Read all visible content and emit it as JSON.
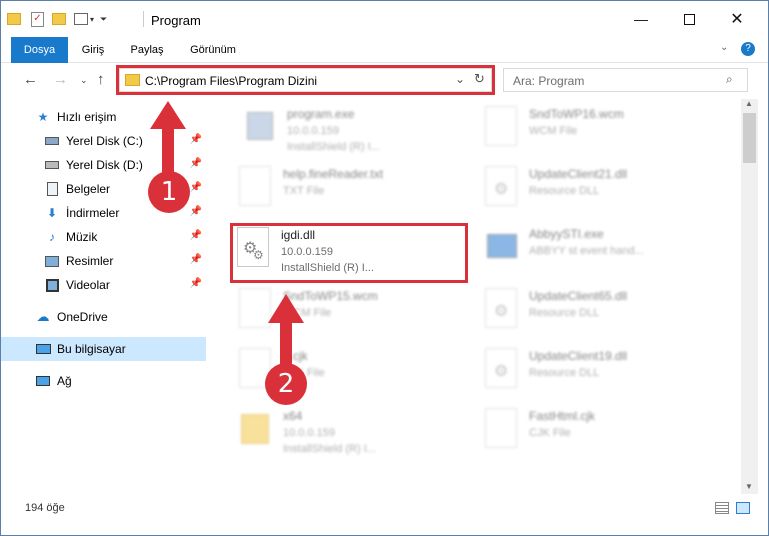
{
  "window": {
    "title": "Program"
  },
  "ribbon": {
    "tabs": [
      "Dosya",
      "Giriş",
      "Paylaş",
      "Görünüm"
    ]
  },
  "address": {
    "path": "C:\\Program Files\\Program Dizini"
  },
  "search": {
    "placeholder": "Ara: Program"
  },
  "sidebar": {
    "items": [
      {
        "label": "Hızlı erişim",
        "icon": "star-icon"
      },
      {
        "label": "Yerel Disk (C:)",
        "icon": "drive-icon"
      },
      {
        "label": "Yerel Disk (D:)",
        "icon": "drive-icon"
      },
      {
        "label": "Belgeler",
        "icon": "documents-icon"
      },
      {
        "label": "İndirmeler",
        "icon": "download-icon"
      },
      {
        "label": "Müzik",
        "icon": "music-icon"
      },
      {
        "label": "Resimler",
        "icon": "pictures-icon"
      },
      {
        "label": "Videolar",
        "icon": "videos-icon"
      },
      {
        "label": "OneDrive",
        "icon": "cloud-icon"
      },
      {
        "label": "Bu bilgisayar",
        "icon": "computer-icon"
      },
      {
        "label": "Ağ",
        "icon": "network-icon"
      }
    ]
  },
  "files": {
    "program_exe": {
      "name": "program.exe",
      "sub1": "10.0.0.159",
      "sub2": "InstallShield (R) I..."
    },
    "help_txt": {
      "name": "help.fineReader.txt",
      "sub1": "TXT File"
    },
    "igdi_dll": {
      "name": "igdi.dll",
      "sub1": "10.0.0.159",
      "sub2": "InstallShield (R) I..."
    },
    "sndtowp15": {
      "name": "SndToWP15.wcm",
      "sub1": "WCM File"
    },
    "d_cjk": {
      "name": "d.cjk",
      "sub1": "CJK File"
    },
    "x64": {
      "name": "x64",
      "sub1": "10.0.0.159",
      "sub2": "InstallShield (R) I..."
    },
    "sndtowp16": {
      "name": "SndToWP16.wcm",
      "sub1": "WCM File"
    },
    "updateclient21": {
      "name": "UpdateClient21.dll",
      "sub1": "Resource DLL"
    },
    "abbyysti": {
      "name": "AbbyySTI.exe",
      "sub1": "ABBYY st event hand..."
    },
    "updateclient65": {
      "name": "UpdateClient65.dll",
      "sub1": "Resource DLL"
    },
    "updateclient19": {
      "name": "UpdateClient19.dll",
      "sub1": "Resource DLL"
    },
    "fasthtml": {
      "name": "FastHtml.cjk",
      "sub1": "CJK File"
    }
  },
  "status": {
    "count": "194 öğe"
  },
  "markers": {
    "one": "1",
    "two": "2"
  },
  "colors": {
    "accent": "#1979ca",
    "highlight": "#d9303a",
    "selected": "#cce8ff"
  }
}
